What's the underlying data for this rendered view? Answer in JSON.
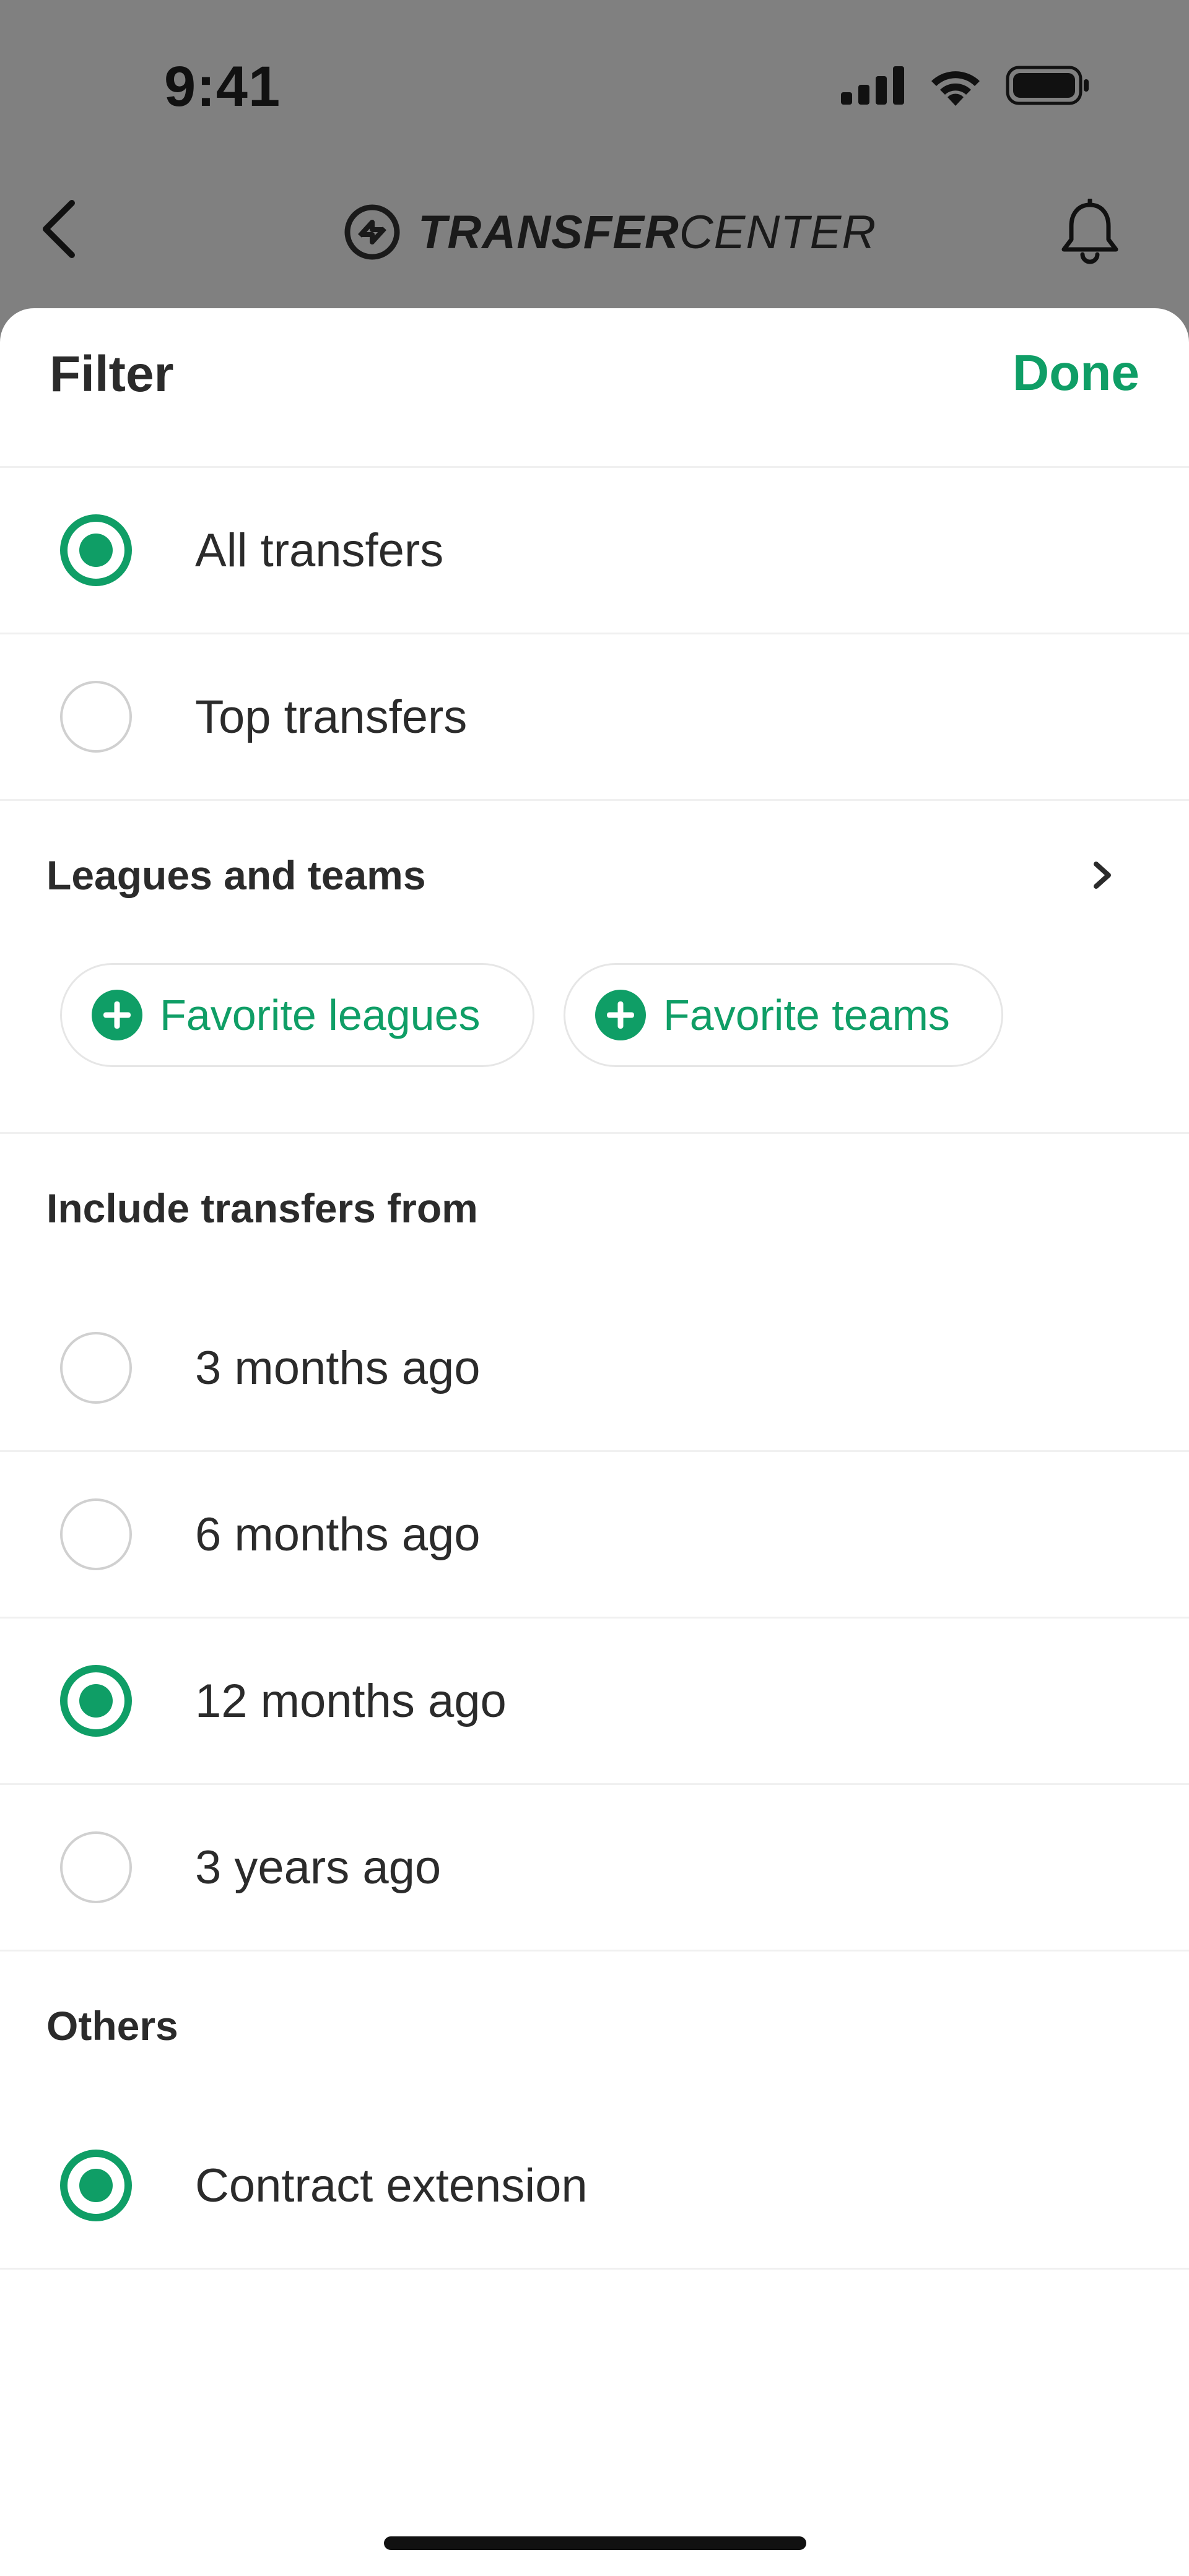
{
  "status_bar": {
    "time": "9:41"
  },
  "nav": {
    "brand_strong": "TRANSFER",
    "brand_light": "CENTER"
  },
  "sheet": {
    "title": "Filter",
    "done_label": "Done",
    "transfer_scope": [
      {
        "label": "All transfers",
        "selected": true
      },
      {
        "label": "Top transfers",
        "selected": false
      }
    ],
    "leagues_section": {
      "title": "Leagues and teams",
      "chips": [
        {
          "label": "Favorite leagues"
        },
        {
          "label": "Favorite teams"
        }
      ]
    },
    "period_section": {
      "title": "Include transfers from",
      "options": [
        {
          "label": "3 months ago",
          "selected": false
        },
        {
          "label": "6 months ago",
          "selected": false
        },
        {
          "label": "12 months ago",
          "selected": true
        },
        {
          "label": "3 years ago",
          "selected": false
        }
      ]
    },
    "others_section": {
      "title": "Others",
      "options": [
        {
          "label": "Contract extension",
          "selected": true
        }
      ]
    }
  },
  "colors": {
    "accent": "#0f9e66",
    "overlay": "#808080",
    "text": "#2b2b2b",
    "divider": "#f0f0f0"
  },
  "icons": {
    "back": "chevron-left-icon",
    "brand": "transfer-arrows-icon",
    "notifications": "bell-icon",
    "leagues_nav": "chevron-right-icon",
    "chip": "plus-circle-icon"
  }
}
